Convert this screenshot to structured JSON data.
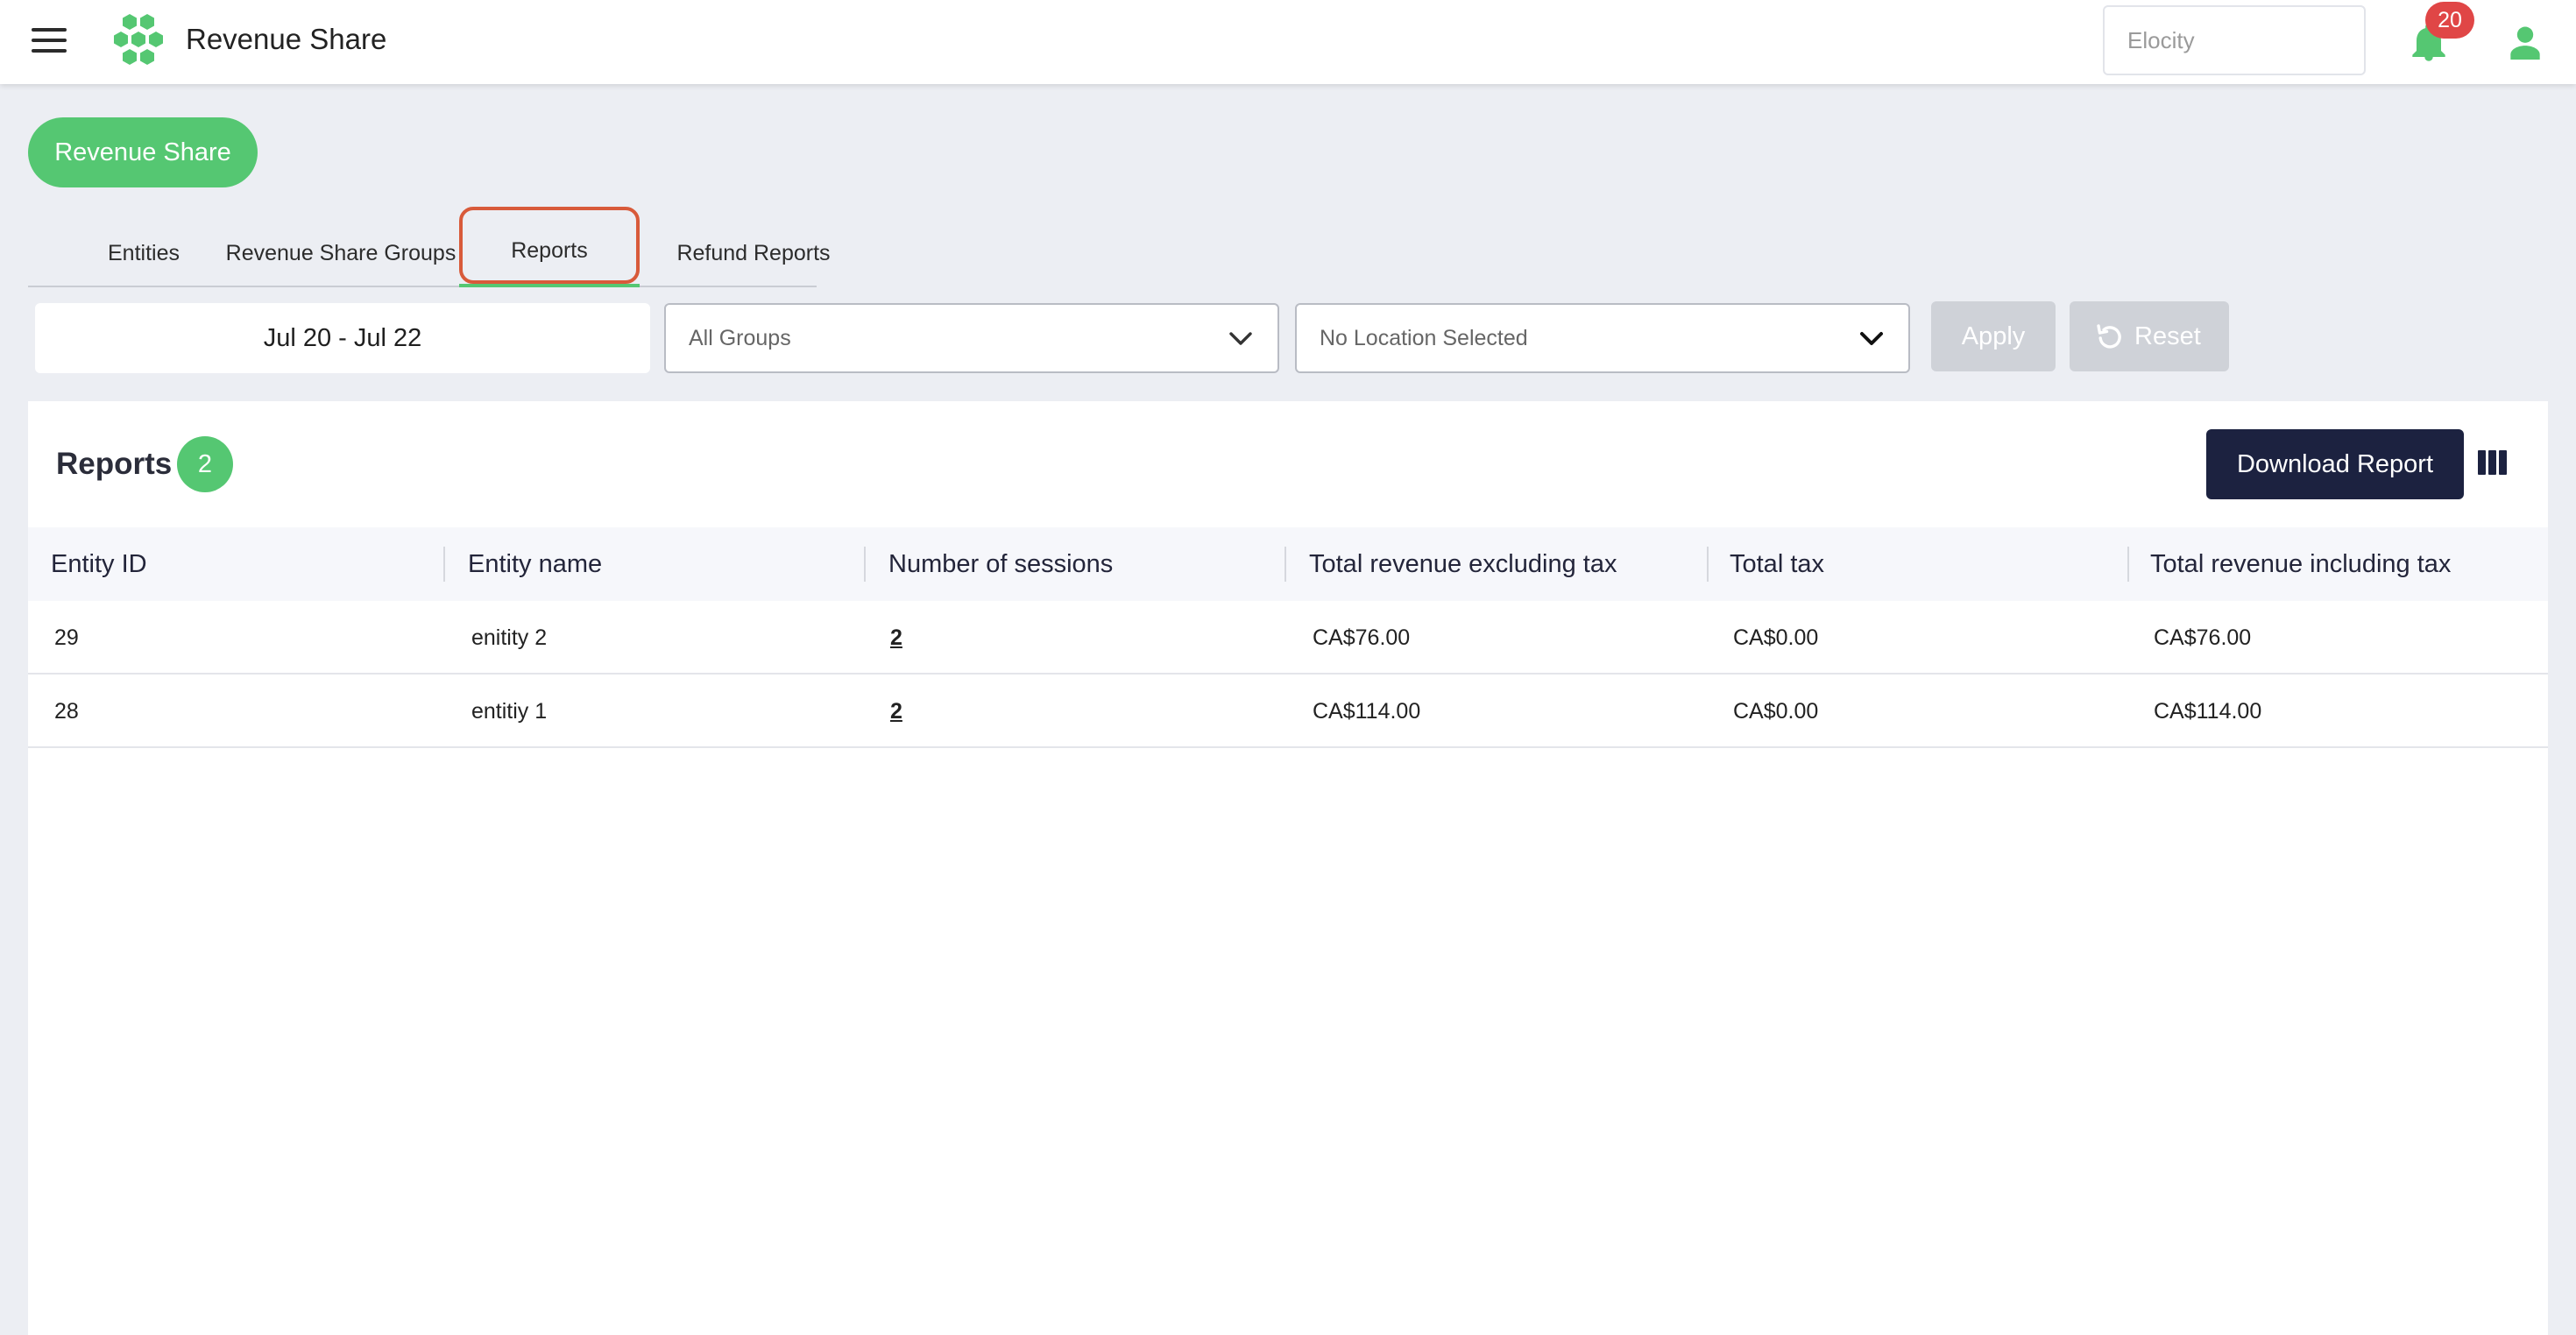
{
  "header": {
    "title": "Revenue Share",
    "org_placeholder": "Elocity",
    "notification_count": "20"
  },
  "page": {
    "pill_label": "Revenue Share"
  },
  "tabs": [
    {
      "label": "Entities"
    },
    {
      "label": "Revenue Share Groups"
    },
    {
      "label": "Reports",
      "active": true
    },
    {
      "label": "Refund Reports"
    }
  ],
  "filters": {
    "date_range": "Jul 20 - Jul 22",
    "group_select": "All Groups",
    "location_select": "No Location Selected",
    "apply_label": "Apply",
    "reset_label": "Reset"
  },
  "report": {
    "title": "Reports",
    "count": "2",
    "download_label": "Download Report",
    "columns": [
      "Entity ID",
      "Entity name",
      "Number of sessions",
      "Total revenue excluding tax",
      "Total tax",
      "Total revenue including tax"
    ],
    "rows": [
      [
        "29",
        "enitity 2",
        "2",
        "CA$76.00",
        "CA$0.00",
        "CA$76.00"
      ],
      [
        "28",
        "entitiy 1",
        "2",
        "CA$114.00",
        "CA$0.00",
        "CA$114.00"
      ]
    ]
  },
  "colors": {
    "accent": "#55c772",
    "primary_dark": "#1c2240",
    "badge_red": "#e04646",
    "highlight": "#d85a3a"
  },
  "icons": {
    "menu": "menu-icon",
    "logo": "honeycomb-logo-icon",
    "notifications": "bell-icon",
    "user": "user-icon",
    "dropdown": "chevron-down-icon",
    "reset": "reset-icon",
    "columns": "columns-icon"
  }
}
